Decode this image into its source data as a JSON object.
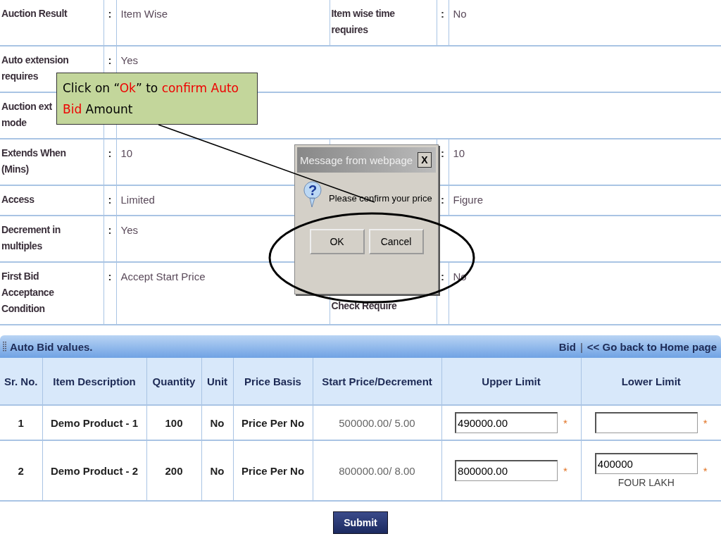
{
  "details": [
    {
      "label": "Auction Result",
      "colon": ":",
      "value": "Item Wise",
      "right": {
        "label": "Item wise time\nrequires",
        "colon": ":",
        "value": "No"
      }
    },
    {
      "label": "Auto extension\nrequires",
      "colon": ":",
      "value": "Yes"
    },
    {
      "label": "Auction ext\nmode"
    },
    {
      "label": "Extends When\n(Mins)",
      "colon": ":",
      "value": "10",
      "right": {
        "colon": ":",
        "value": "10"
      }
    },
    {
      "label": "Access",
      "colon": ":",
      "value": "Limited",
      "right": {
        "colon": ":",
        "value": "Figure"
      }
    },
    {
      "label": "Decrement in\nmultiples",
      "colon": ":",
      "value": "Yes"
    },
    {
      "label": "First Bid\nAcceptance\nCondition",
      "colon": ":",
      "value": "Accept Start Price",
      "right": {
        "label": "Check Require",
        "colon": ":",
        "value": "No"
      }
    }
  ],
  "bid_panel": {
    "title": "Auto Bid values.",
    "links": [
      {
        "kind": "link",
        "text": "Bid"
      },
      {
        "kind": "separator",
        "text": "|"
      },
      {
        "kind": "link",
        "text": "<< Go back to Home page"
      }
    ],
    "columns": [
      "Sr. No.",
      "Item Description",
      "Quantity",
      "Unit",
      "Price Basis",
      "Start Price/Decrement",
      "Upper Limit",
      "Lower Limit"
    ],
    "rows": [
      {
        "sr": "1",
        "description": "Demo Product - 1",
        "quantity": "100",
        "unit": "No",
        "price_basis": "Price Per No",
        "start_price": "500000.00/ 5.00",
        "upper_limit": "490000.00",
        "upper_mark": "*",
        "lower_limit": "",
        "lower_mark": "*"
      },
      {
        "sr": "2",
        "description": "Demo Product - 2",
        "quantity": "200",
        "unit": "No",
        "price_basis": "Price Per No",
        "start_price": "800000.00/ 8.00",
        "upper_limit": "800000.00",
        "upper_mark": "*",
        "lower_limit": "400000",
        "lower_mark": "*",
        "lower_words": "FOUR LAKH"
      }
    ],
    "submit": "Submit"
  },
  "dialog": {
    "title": "Message from webpage",
    "close": "X",
    "icon": "?",
    "message": "Please confirm your price",
    "buttons": [
      "OK",
      "Cancel"
    ]
  },
  "callout": {
    "parts": [
      {
        "text": "Click on “",
        "highlight": false
      },
      {
        "text": "Ok",
        "highlight": true
      },
      {
        "text": "” to ",
        "highlight": false
      },
      {
        "text": "confirm ",
        "highlight": true
      },
      {
        "text": "Auto Bid",
        "highlight": true
      },
      {
        "text": " Amount",
        "highlight": false
      }
    ]
  }
}
